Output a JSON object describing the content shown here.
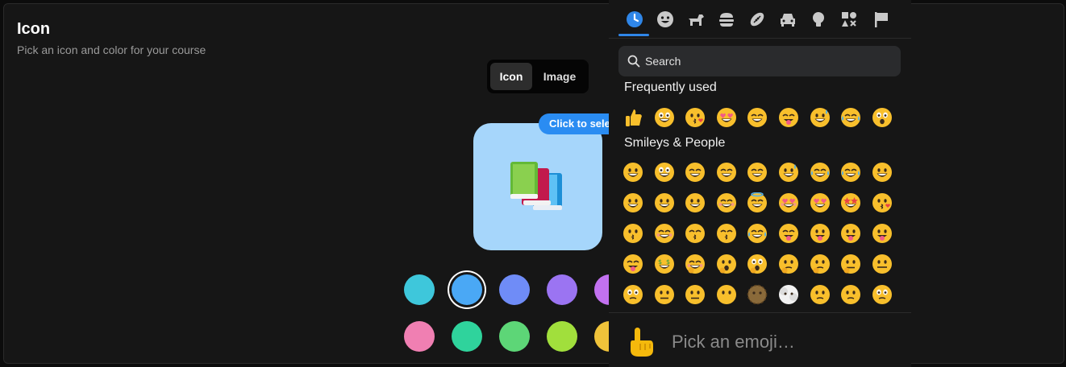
{
  "icon_section": {
    "title": "Icon",
    "subtitle": "Pick an icon and color for your course"
  },
  "segmented_control": {
    "options": [
      {
        "label": "Icon",
        "active": true
      },
      {
        "label": "Image",
        "active": false
      }
    ]
  },
  "tooltip": {
    "text": "Click to select"
  },
  "preview": {
    "background": "#a6d6fb",
    "icon": "books-icon"
  },
  "swatches": {
    "row1": [
      "#3ec7db",
      "#4aa8f5",
      "#6f8cf7",
      "#9b74f2",
      "#c271f0"
    ],
    "row2": [
      "#f07fb2",
      "#2fd39c",
      "#5dd677",
      "#a1df3c",
      "#f0c33a"
    ],
    "selected": "#4aa8f5"
  },
  "emoji_picker": {
    "categories": [
      "clock-icon",
      "smiley-icon",
      "animal-icon",
      "food-icon",
      "activity-icon",
      "car-icon",
      "lightbulb-icon",
      "symbols-icon",
      "flag-icon"
    ],
    "active_category": "clock-icon",
    "accent": "#2f86e8",
    "search_placeholder": "Search",
    "sections": [
      {
        "title": "Frequently used",
        "rows": [
          [
            "thumbs-up",
            "grinning-big-eyes",
            "kissing-heart",
            "heart-eyes",
            "squinting-laugh",
            "yum",
            "sweat-smile",
            "joy",
            "scream"
          ]
        ]
      },
      {
        "title": "Smileys & People",
        "rows": [
          [
            "grinning",
            "grinning-big-eyes",
            "grin-smile-eyes",
            "beaming",
            "squinting",
            "sweat-smile",
            "rofl",
            "joy",
            "slight-smile"
          ],
          [
            "upside-down",
            "melting",
            "wink",
            "blush",
            "halo",
            "smiling-hearts",
            "heart-eyes",
            "star-struck",
            "kissing-heart"
          ],
          [
            "kissing",
            "relaxed",
            "kissing-closed",
            "kissing-smiling",
            "tear-smile",
            "yum",
            "tongue",
            "tongue-wink",
            "zany"
          ],
          [
            "squint-tongue",
            "money-mouth",
            "hugging",
            "hand-over-mouth",
            "open-eyes-hand",
            "shushing",
            "thinking",
            "saluting",
            "zipper-mouth"
          ],
          [
            "raised-eyebrow",
            "neutral",
            "expressionless",
            "no-mouth",
            "dotted-line",
            "face-in-clouds",
            "smirk",
            "unamused",
            "rolling-eyes"
          ]
        ]
      }
    ],
    "footer_placeholder": "Pick an emoji…",
    "footer_icon": "pointing-up-icon"
  }
}
